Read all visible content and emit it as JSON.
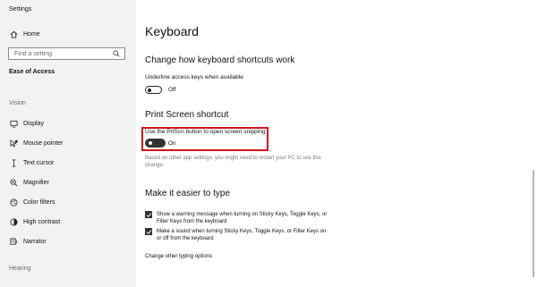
{
  "window": {
    "title": "Settings",
    "minimize_icon": "minimize-icon",
    "maximize_icon": "maximize-icon",
    "close_icon": "close-icon"
  },
  "sidebar": {
    "home": {
      "label": "Home",
      "icon": "home-icon"
    },
    "search_placeholder": "Find a setting",
    "category": "Ease of Access",
    "vision_section": "Vision",
    "items": [
      {
        "label": "Display",
        "icon": "display-icon"
      },
      {
        "label": "Mouse pointer",
        "icon": "mouse-pointer-icon"
      },
      {
        "label": "Text cursor",
        "icon": "text-cursor-icon"
      },
      {
        "label": "Magnifier",
        "icon": "magnifier-icon"
      },
      {
        "label": "Color filters",
        "icon": "color-filters-icon"
      },
      {
        "label": "High contrast",
        "icon": "high-contrast-icon"
      },
      {
        "label": "Narrator",
        "icon": "narrator-icon"
      }
    ],
    "hearing_section": "Hearing"
  },
  "main": {
    "page_title": "Keyboard",
    "shortcuts": {
      "heading": "Change how keyboard shortcuts work",
      "underline_label": "Underline access keys when available",
      "underline_state": "Off",
      "underline_on": false
    },
    "print_screen": {
      "heading": "Print Screen shortcut",
      "toggle_label": "Use the PrtScn button to open screen snipping",
      "toggle_state": "On",
      "toggle_on": true,
      "note": "Based on other app settings, you might need to restart your PC to see this change."
    },
    "easier": {
      "heading": "Make it easier to type",
      "checks": [
        {
          "label": "Show a warning message when turning on Sticky Keys, Toggle Keys, or Filter Keys from the keyboard",
          "checked": true
        },
        {
          "label": "Make a sound when turning Sticky Keys, Toggle Keys, or Filter Keys on or off from the keyboard",
          "checked": true
        }
      ],
      "link": "Change other typing options"
    }
  },
  "colors": {
    "highlight": "#d4131a",
    "sidebar_bg": "#f2f2f2",
    "toggle_on": "#333333"
  }
}
